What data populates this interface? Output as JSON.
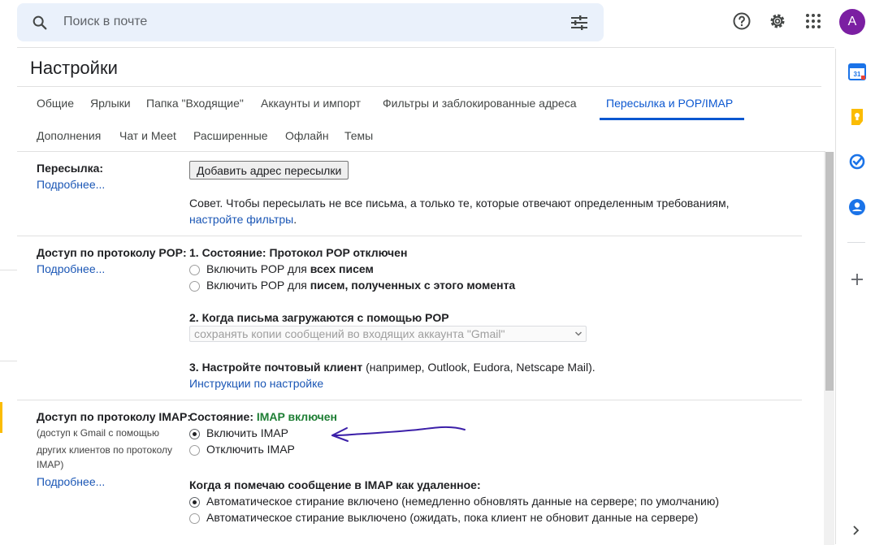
{
  "search": {
    "placeholder": "Поиск в почте"
  },
  "account": {
    "avatar_letter": "A"
  },
  "settings": {
    "title": "Настройки",
    "tabs_row1": [
      "Общие",
      "Ярлыки",
      "Папка \"Входящие\"",
      "Аккаунты и импорт",
      "Фильтры и заблокированные адреса",
      "Пересылка и POP/IMAP"
    ],
    "tabs_row2": [
      "Дополнения",
      "Чат и Meet",
      "Расширенные",
      "Офлайн",
      "Темы"
    ],
    "active_tab": "Пересылка и POP/IMAP"
  },
  "forwarding": {
    "label": "Пересылка:",
    "more": "Подробнее...",
    "add_button": "Добавить адрес пересылки",
    "tip": "Совет. Чтобы пересылать не все письма, а только те, которые отвечают определенным требованиям,",
    "tip_link": "настройте фильтры",
    "tip_end": "."
  },
  "pop": {
    "label": "Доступ по протоколу POP:",
    "more": "Подробнее...",
    "status": "1. Состояние: Протокол POP отключен",
    "opt1_prefix": "Включить POP для ",
    "opt1_bold": "всех писем",
    "opt2_prefix": "Включить POP для ",
    "opt2_bold": "писем, полученных с этого момента",
    "when_title": "2. Когда письма загружаются с помощью POP",
    "when_select": "сохранять копии сообщений во входящих аккаунта \"Gmail\"",
    "client_bold": "3. Настройте почтовый клиент",
    "client_rest": " (например, Outlook, Eudora, Netscape Mail).",
    "instructions": "Инструкции по настройке"
  },
  "imap": {
    "label": "Доступ по протоколу IMAP:",
    "sub1": "(доступ к Gmail с помощью",
    "sub2": "других клиентов по протоколу",
    "sub3": "IMAP)",
    "more": "Подробнее...",
    "status_prefix": "Состояние: ",
    "status_value": "IMAP включен",
    "enable": "Включить IMAP",
    "disable": "Отключить IMAP",
    "enabled": true,
    "delete_title": "Когда я помечаю сообщение в IMAP как удаленное:",
    "auto_on": "Автоматическое стирание включено (немедленно обновлять данные на сервере; по умолчанию)",
    "auto_off": "Автоматическое стирание выключено (ожидать, пока клиент не обновит данные на сервере)",
    "auto_expunge_on": true
  },
  "colors": {
    "accent": "#0b57d0",
    "link": "#1a56b5",
    "status_green": "#1e7e34",
    "annotation": "#3b1fa8"
  },
  "icons": [
    "search-icon",
    "tune-icon",
    "help-icon",
    "gear-icon",
    "apps-icon",
    "calendar-icon",
    "keep-icon",
    "tasks-icon",
    "contacts-icon",
    "plus-icon",
    "chevron-right-icon"
  ]
}
